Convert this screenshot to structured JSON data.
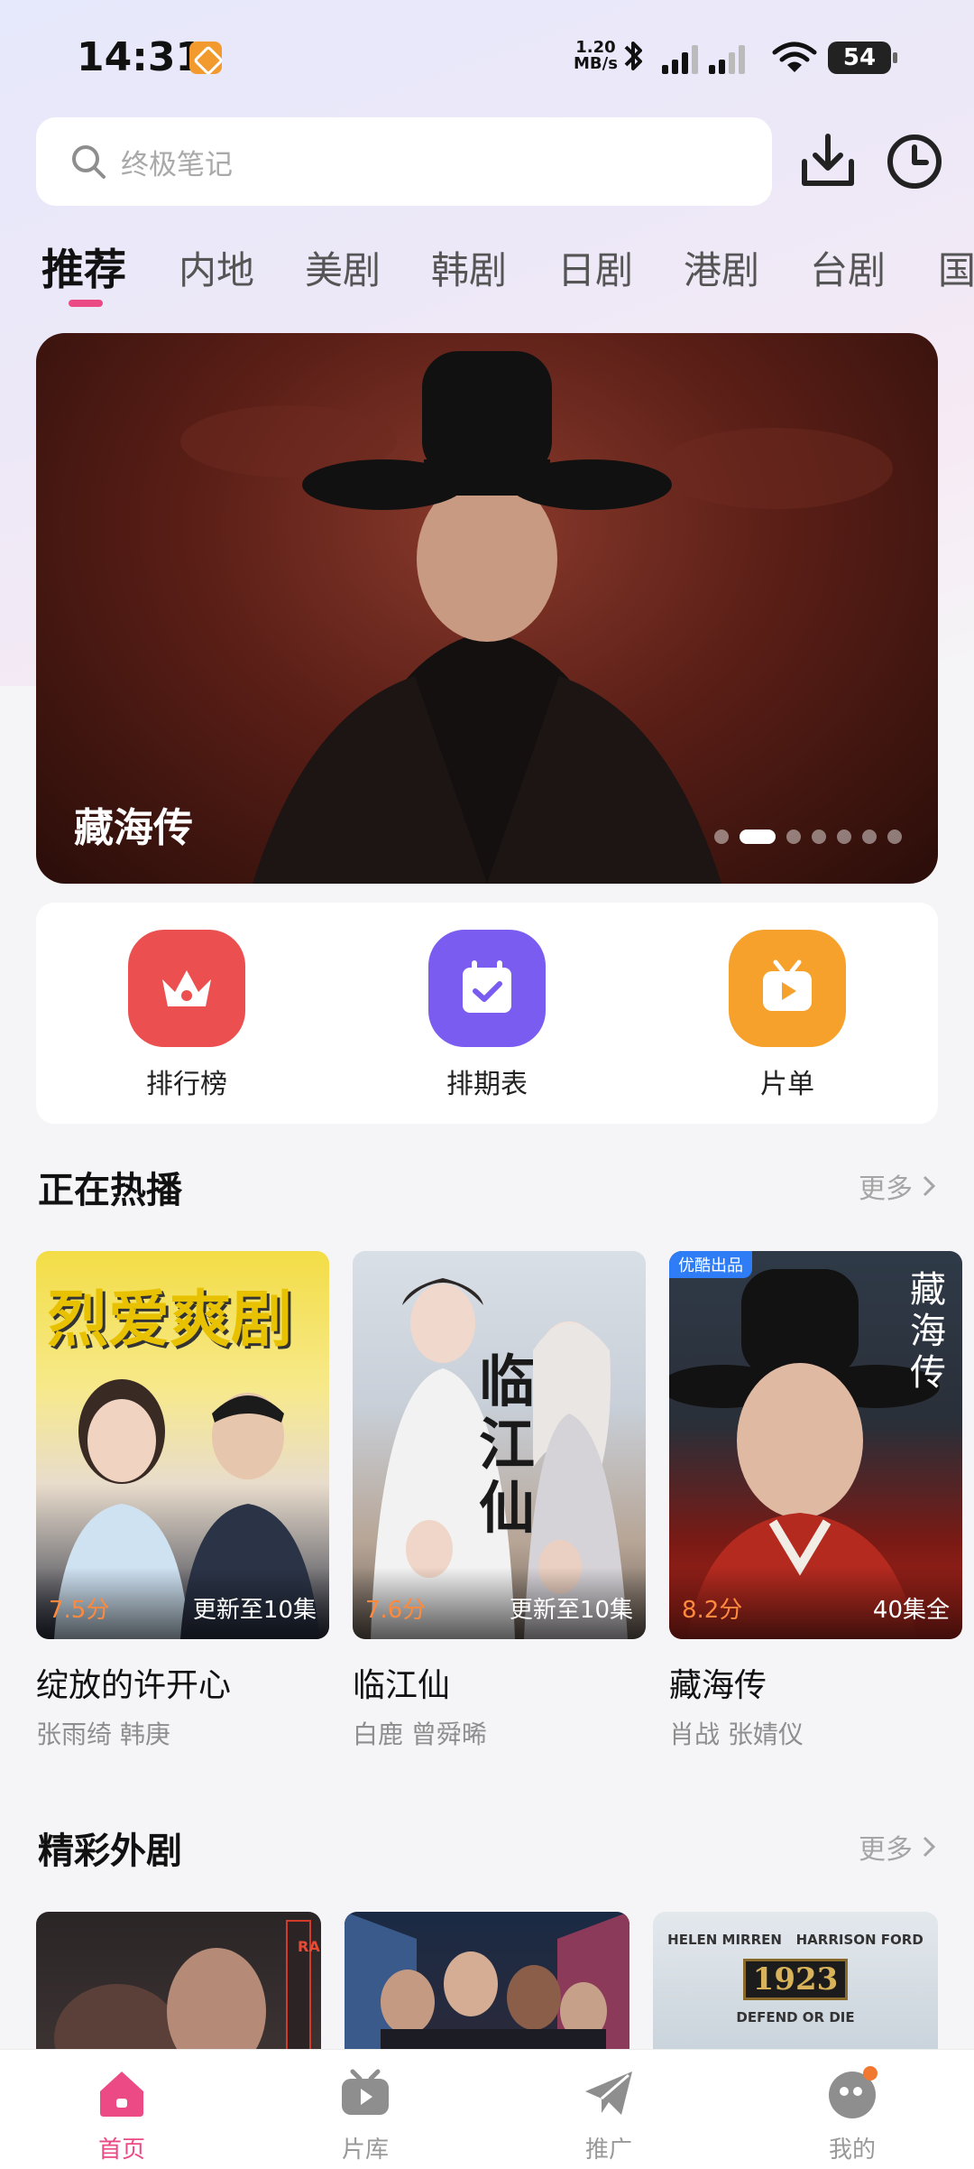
{
  "status_bar": {
    "time": "14:31",
    "net_speed_value": "1.20",
    "net_speed_unit": "MB/s",
    "battery": "54"
  },
  "search": {
    "placeholder": "终极笔记"
  },
  "tabs": [
    {
      "label": "推荐",
      "active": true
    },
    {
      "label": "内地"
    },
    {
      "label": "美剧"
    },
    {
      "label": "韩剧"
    },
    {
      "label": "日剧"
    },
    {
      "label": "港剧"
    },
    {
      "label": "台剧"
    },
    {
      "label": "国"
    }
  ],
  "banner": {
    "title": "藏海传",
    "slide_count": 7,
    "active_slide": 2
  },
  "quick_entries": [
    {
      "label": "排行榜",
      "icon": "crown-icon",
      "color": "#ec4f4f"
    },
    {
      "label": "排期表",
      "icon": "calendar-icon",
      "color": "#7a5cf0"
    },
    {
      "label": "片单",
      "icon": "tv-play-icon",
      "color": "#f6a12b"
    }
  ],
  "hot_section": {
    "title": "正在热播",
    "more": "更多",
    "items": [
      {
        "title": "绽放的许开心",
        "cast": "张雨绮 韩庚",
        "score": "7.5分",
        "update": "更新至10集",
        "poster_text": "烈爱爽剧"
      },
      {
        "title": "临江仙",
        "cast": "白鹿 曾舜晞",
        "score": "7.6分",
        "update": "更新至10集",
        "poster_text": "临江仙"
      },
      {
        "title": "藏海传",
        "cast": "肖战 张婧仪",
        "score": "8.2分",
        "update": "40集全",
        "poster_text": "藏海传",
        "badge": "优酷出品"
      }
    ]
  },
  "foreign_section": {
    "title": "精彩外剧",
    "more": "更多",
    "posters": [
      {
        "text": "RADIO"
      },
      {
        "text": ""
      },
      {
        "text_top": "HELEN MIRREN   HARRISON FORD",
        "text_main": "1923",
        "text_sub": "DEFEND OR DIE"
      }
    ]
  },
  "bottom_nav": [
    {
      "label": "首页",
      "icon": "home-icon",
      "active": true
    },
    {
      "label": "片库",
      "icon": "library-icon"
    },
    {
      "label": "推广",
      "icon": "paper-plane-icon"
    },
    {
      "label": "我的",
      "icon": "profile-icon"
    }
  ],
  "colors": {
    "accent": "#ec4a84",
    "score": "#ff8a3d"
  }
}
